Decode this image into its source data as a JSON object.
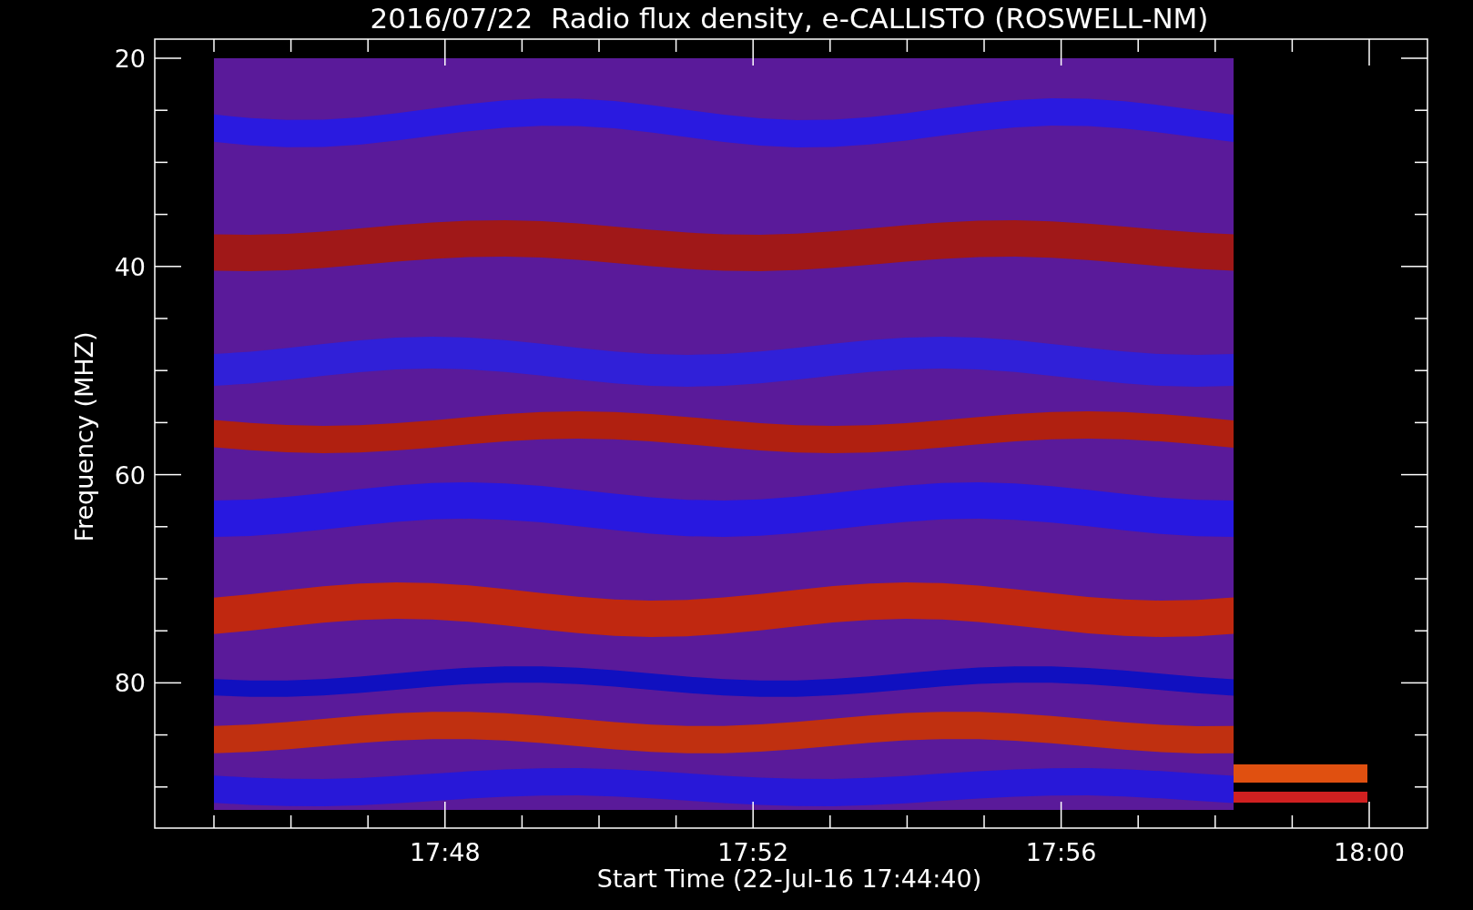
{
  "chart": {
    "title": "2016/07/22  Radio flux density, e-CALLISTO (ROSWELL-NM)",
    "y_axis": {
      "label": "Frequency (MHZ)",
      "ticks": [
        "20",
        "40",
        "60",
        "80"
      ]
    },
    "x_axis": {
      "label": "Start Time (22-Jul-16 17:44:40)",
      "ticks": [
        "17:48",
        "17:52",
        "17:56",
        "18:00"
      ]
    }
  }
}
